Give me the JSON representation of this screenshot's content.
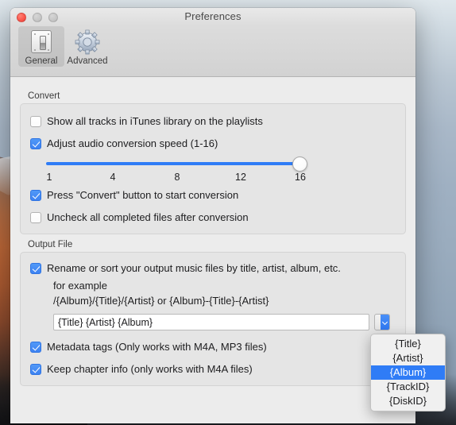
{
  "window": {
    "title": "Preferences",
    "traffic_lights": [
      "close",
      "minimize",
      "maximize"
    ]
  },
  "toolbar": {
    "tabs": [
      {
        "label": "General",
        "icon": "switch-plate-icon",
        "selected": true
      },
      {
        "label": "Advanced",
        "icon": "gear-icon",
        "selected": false
      }
    ]
  },
  "convert": {
    "group_title": "Convert",
    "options": [
      {
        "label": "Show all tracks in iTunes library on the playlists",
        "checked": false
      },
      {
        "label": "Adjust audio conversion speed (1-16)",
        "checked": true
      },
      {
        "label": "Press \"Convert\" button to start conversion",
        "checked": true
      },
      {
        "label": "Uncheck all completed files after conversion",
        "checked": false
      }
    ],
    "slider": {
      "min": 1,
      "max": 16,
      "value": 16,
      "ticks": [
        "1",
        "4",
        "8",
        "12",
        "16"
      ]
    }
  },
  "output_file": {
    "group_title": "Output File",
    "rename_option": {
      "label": "Rename or sort your output music files by title, artist, album, etc.",
      "checked": true
    },
    "example_label": "for example",
    "example_pattern": "/{Album}/{Title}/{Artist} or {Album}-{Title}-{Artist}",
    "pattern_field": {
      "value": "{Title} {Artist} {Album}",
      "placeholder": "{Title} {Artist} {Album}"
    },
    "dropdown": {
      "icon": "chevron-down-icon",
      "open": true,
      "selected": "{Album}",
      "options": [
        "{Title}",
        "{Artist}",
        "{Album}",
        "{TrackID}",
        "{DiskID}"
      ]
    },
    "options": [
      {
        "label": "Metadata tags (Only works with M4A, MP3 files)",
        "checked": true
      },
      {
        "label": "Keep chapter info (only works with  M4A files)",
        "checked": true
      }
    ]
  },
  "colors": {
    "accent_blue": "#2f7cf6",
    "checkbox_blue": "#3d82f2",
    "window_bg": "#ececec",
    "group_bg": "#e5e5e5"
  }
}
